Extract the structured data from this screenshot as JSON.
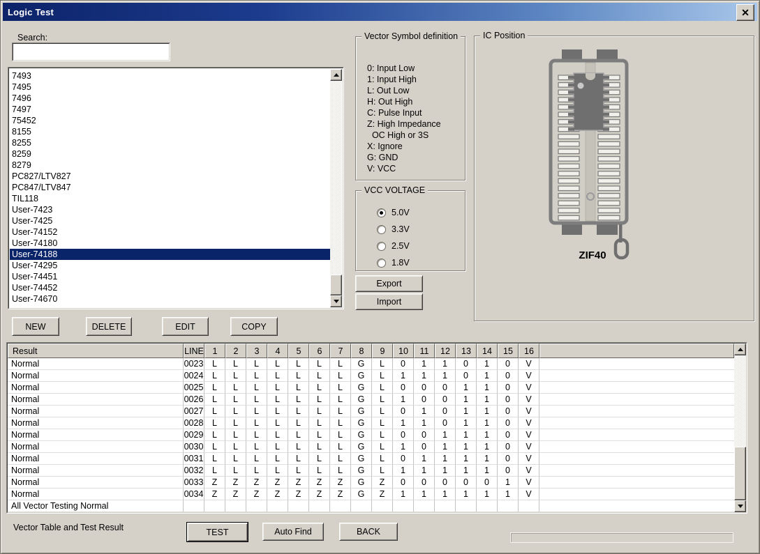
{
  "window": {
    "title": "Logic Test",
    "close_glyph": "✕"
  },
  "search": {
    "label": "Search:",
    "value": ""
  },
  "device_list": {
    "items": [
      "7493",
      "7495",
      "7496",
      "7497",
      "75452",
      "8155",
      "8255",
      "8259",
      "8279",
      "PC827/LTV827",
      "PC847/LTV847",
      "TIL118",
      "User-7423",
      "User-7425",
      "User-74152",
      "User-74180",
      "User-74188",
      "User-74295",
      "User-74451",
      "User-74452",
      "User-74670"
    ],
    "selected": "User-74188"
  },
  "list_buttons": {
    "new": "NEW",
    "delete": "DELETE",
    "edit": "EDIT",
    "copy": "COPY"
  },
  "vector_symbols": {
    "title": "Vector Symbol definition",
    "lines": [
      "0: Input Low",
      "1: Input High",
      "L: Out Low",
      "H: Out High",
      "C: Pulse Input",
      "Z: High Impedance",
      "  OC High or 3S",
      "X: Ignore",
      "G: GND",
      "V: VCC"
    ]
  },
  "vcc_voltage": {
    "title": "VCC VOLTAGE",
    "options": [
      {
        "label": "5.0V",
        "selected": true
      },
      {
        "label": "3.3V",
        "selected": false
      },
      {
        "label": "2.5V",
        "selected": false
      },
      {
        "label": "1.8V",
        "selected": false
      }
    ]
  },
  "io_buttons": {
    "export": "Export",
    "import": "Import"
  },
  "ic_position": {
    "title": "IC Position",
    "socket_label": "ZIF40"
  },
  "result_table": {
    "columns": [
      "Result",
      "LINE",
      "1",
      "2",
      "3",
      "4",
      "5",
      "6",
      "7",
      "8",
      "9",
      "10",
      "11",
      "12",
      "13",
      "14",
      "15",
      "16"
    ],
    "rows": [
      {
        "result": "Normal",
        "line": "0023",
        "values": [
          "L",
          "L",
          "L",
          "L",
          "L",
          "L",
          "L",
          "G",
          "L",
          "0",
          "1",
          "1",
          "0",
          "1",
          "0",
          "V"
        ]
      },
      {
        "result": "Normal",
        "line": "0024",
        "values": [
          "L",
          "L",
          "L",
          "L",
          "L",
          "L",
          "L",
          "G",
          "L",
          "1",
          "1",
          "1",
          "0",
          "1",
          "0",
          "V"
        ]
      },
      {
        "result": "Normal",
        "line": "0025",
        "values": [
          "L",
          "L",
          "L",
          "L",
          "L",
          "L",
          "L",
          "G",
          "L",
          "0",
          "0",
          "0",
          "1",
          "1",
          "0",
          "V"
        ]
      },
      {
        "result": "Normal",
        "line": "0026",
        "values": [
          "L",
          "L",
          "L",
          "L",
          "L",
          "L",
          "L",
          "G",
          "L",
          "1",
          "0",
          "0",
          "1",
          "1",
          "0",
          "V"
        ]
      },
      {
        "result": "Normal",
        "line": "0027",
        "values": [
          "L",
          "L",
          "L",
          "L",
          "L",
          "L",
          "L",
          "G",
          "L",
          "0",
          "1",
          "0",
          "1",
          "1",
          "0",
          "V"
        ]
      },
      {
        "result": "Normal",
        "line": "0028",
        "values": [
          "L",
          "L",
          "L",
          "L",
          "L",
          "L",
          "L",
          "G",
          "L",
          "1",
          "1",
          "0",
          "1",
          "1",
          "0",
          "V"
        ]
      },
      {
        "result": "Normal",
        "line": "0029",
        "values": [
          "L",
          "L",
          "L",
          "L",
          "L",
          "L",
          "L",
          "G",
          "L",
          "0",
          "0",
          "1",
          "1",
          "1",
          "0",
          "V"
        ]
      },
      {
        "result": "Normal",
        "line": "0030",
        "values": [
          "L",
          "L",
          "L",
          "L",
          "L",
          "L",
          "L",
          "G",
          "L",
          "1",
          "0",
          "1",
          "1",
          "1",
          "0",
          "V"
        ]
      },
      {
        "result": "Normal",
        "line": "0031",
        "values": [
          "L",
          "L",
          "L",
          "L",
          "L",
          "L",
          "L",
          "G",
          "L",
          "0",
          "1",
          "1",
          "1",
          "1",
          "0",
          "V"
        ]
      },
      {
        "result": "Normal",
        "line": "0032",
        "values": [
          "L",
          "L",
          "L",
          "L",
          "L",
          "L",
          "L",
          "G",
          "L",
          "1",
          "1",
          "1",
          "1",
          "1",
          "0",
          "V"
        ]
      },
      {
        "result": "Normal",
        "line": "0033",
        "values": [
          "Z",
          "Z",
          "Z",
          "Z",
          "Z",
          "Z",
          "Z",
          "G",
          "Z",
          "0",
          "0",
          "0",
          "0",
          "0",
          "1",
          "V"
        ]
      },
      {
        "result": "Normal",
        "line": "0034",
        "values": [
          "Z",
          "Z",
          "Z",
          "Z",
          "Z",
          "Z",
          "Z",
          "G",
          "Z",
          "1",
          "1",
          "1",
          "1",
          "1",
          "1",
          "V"
        ]
      },
      {
        "result": "All Vector Testing Normal",
        "line": "",
        "values": [
          "",
          "",
          "",
          "",
          "",
          "",
          "",
          "",
          "",
          "",
          "",
          "",
          "",
          "",
          "",
          ""
        ]
      }
    ]
  },
  "footer": {
    "caption": "Vector Table and Test Result",
    "test": "TEST",
    "auto_find": "Auto Find",
    "back": "BACK"
  }
}
